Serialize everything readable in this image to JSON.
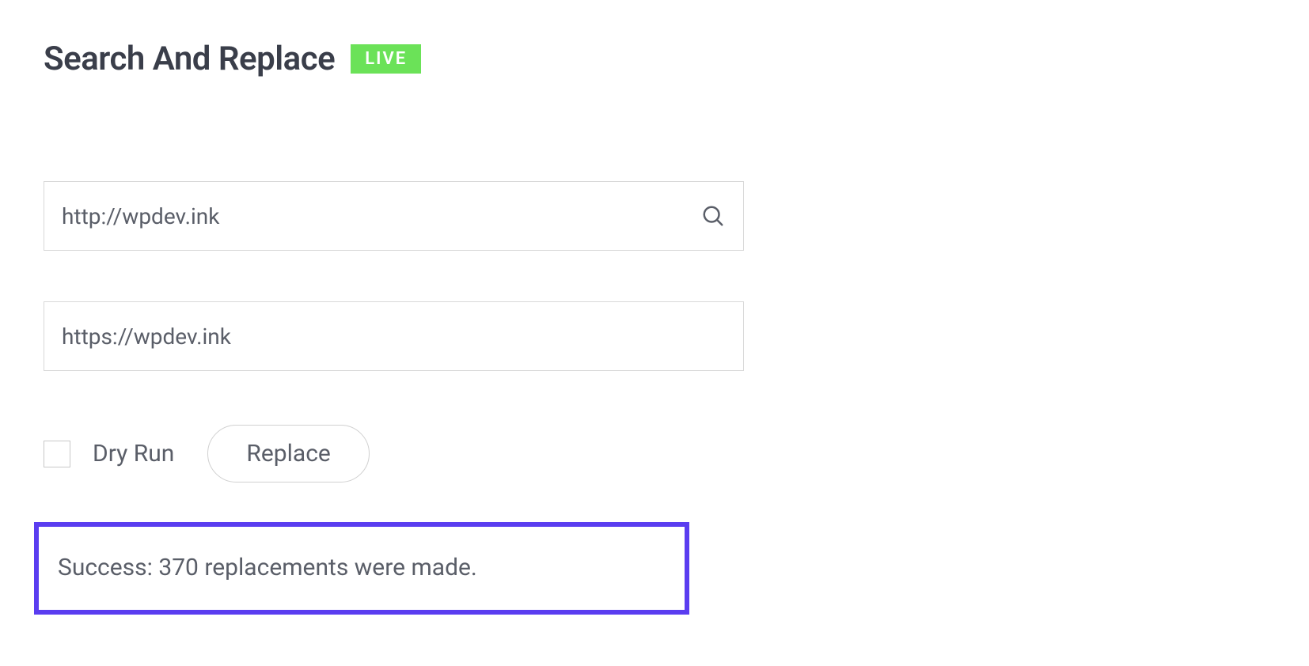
{
  "header": {
    "title": "Search And Replace",
    "badge": "LIVE"
  },
  "form": {
    "search_value": "http://wpdev.ink",
    "replace_value": "https://wpdev.ink",
    "dry_run_label": "Dry Run",
    "replace_button": "Replace"
  },
  "result": {
    "message": "Success: 370 replacements were made."
  },
  "colors": {
    "badge_bg": "#6be258",
    "highlight_border": "#5a3df0"
  }
}
